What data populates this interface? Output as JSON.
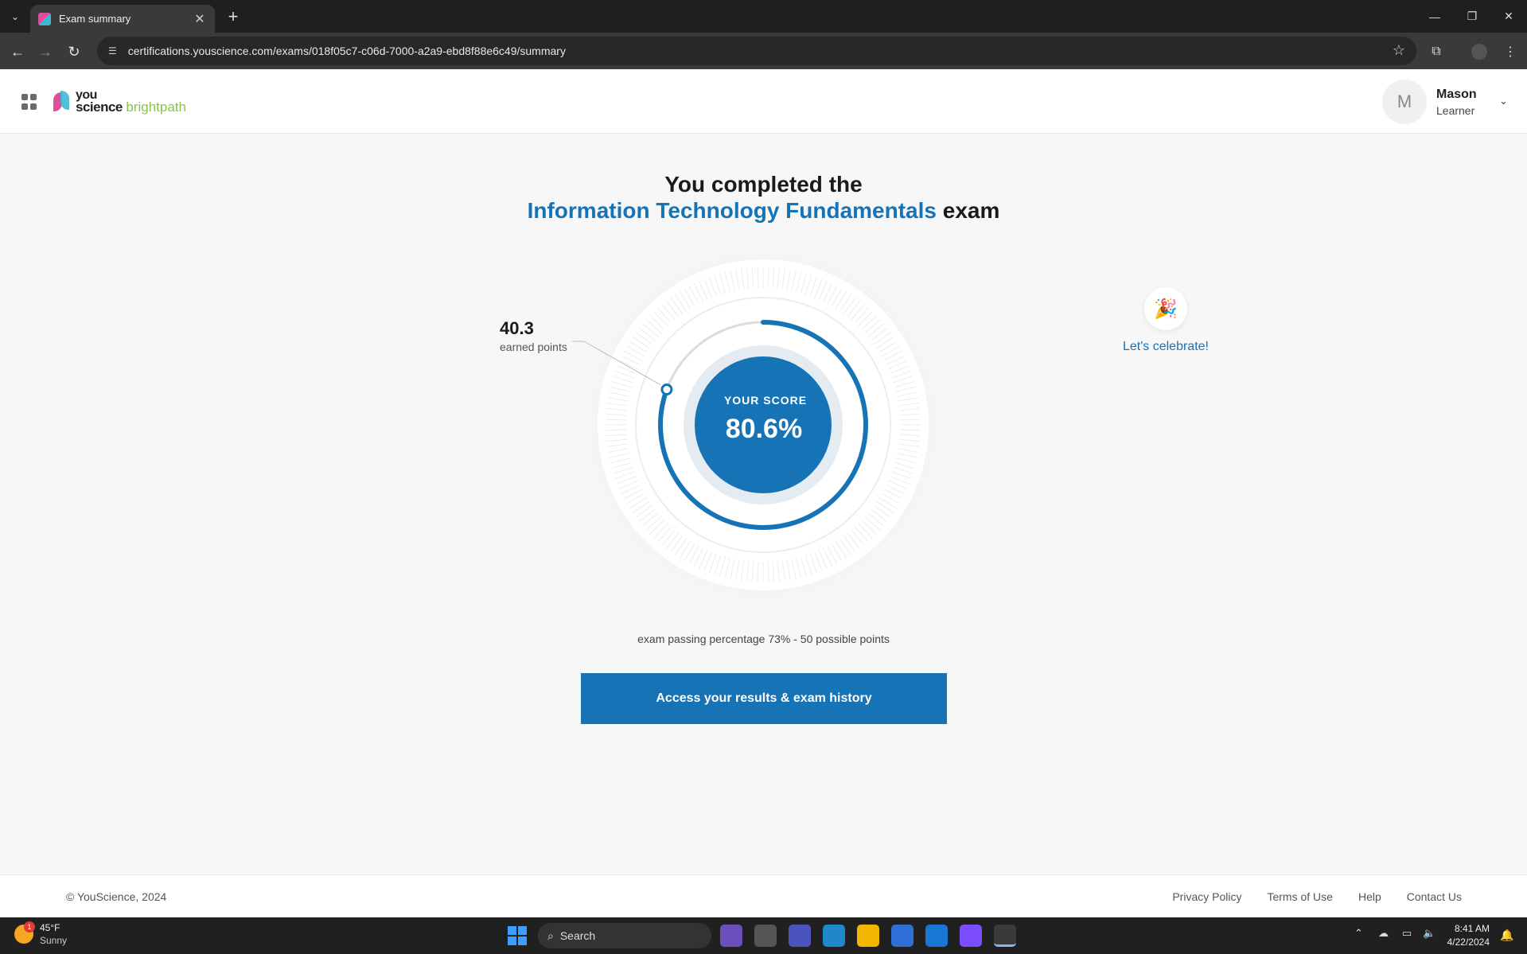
{
  "browser": {
    "tab_title": "Exam summary",
    "tab_close": "✕",
    "new_tab": "+",
    "url": "certifications.youscience.com/exams/018f05c7-c06d-7000-a2a9-ebd8f88e6c49/summary"
  },
  "header": {
    "logo_you": "you",
    "logo_science": "science",
    "logo_brightpath": "brightpath",
    "user_initial": "M",
    "user_name": "Mason",
    "user_role": "Learner"
  },
  "main": {
    "heading_line1": "You completed the",
    "exam_name": "Information Technology Fundamentals",
    "heading_suffix": "exam",
    "score_label": "YOUR SCORE",
    "score_value": "80.6%",
    "score_fraction": 0.806,
    "earned_points": "40.3",
    "earned_points_label": "earned points",
    "celebrate_label": "Let's celebrate!",
    "passing_text": "exam passing percentage 73% - 50 possible points",
    "cta_label": "Access your results & exam history"
  },
  "footer": {
    "copyright": "© YouScience, 2024",
    "links": [
      "Privacy Policy",
      "Terms of Use",
      "Help",
      "Contact Us"
    ]
  },
  "taskbar": {
    "weather_temp": "45°F",
    "weather_desc": "Sunny",
    "weather_badge": "1",
    "search_label": "Search",
    "time": "8:41 AM",
    "date": "4/22/2024"
  },
  "colors": {
    "accent": "#1673b6",
    "brand_green": "#8bc34a"
  }
}
